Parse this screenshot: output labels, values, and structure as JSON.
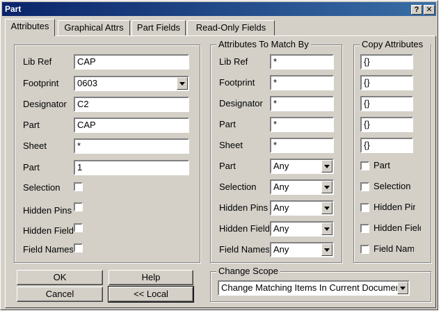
{
  "window": {
    "title": "Part"
  },
  "tabs": [
    "Attributes",
    "Graphical Attrs",
    "Part Fields",
    "Read-Only Fields"
  ],
  "attributes": {
    "lib_ref_label": "Lib Ref",
    "lib_ref": "CAP",
    "footprint_label": "Footprint",
    "footprint": "0603",
    "designator_label": "Designator",
    "designator": "C2",
    "part_label": "Part",
    "part": "CAP",
    "sheet_label": "Sheet",
    "sheet": "*",
    "part_num_label": "Part",
    "part_num": "1",
    "selection_label": "Selection",
    "hidden_pins_label": "Hidden Pins",
    "hidden_fields_label": "Hidden Fields",
    "field_names_label": "Field Names"
  },
  "match": {
    "title": "Attributes To Match By",
    "lib_ref_label": "Lib Ref",
    "lib_ref": "*",
    "footprint_label": "Footprint",
    "footprint": "*",
    "designator_label": "Designator",
    "designator": "*",
    "part_label": "Part",
    "part": "*",
    "sheet_label": "Sheet",
    "sheet": "*",
    "part_num_label": "Part",
    "part_num": "Any",
    "selection_label": "Selection",
    "selection": "Any",
    "hidden_pins_label": "Hidden Pins",
    "hidden_pins": "Any",
    "hidden_fields_label": "Hidden Fields",
    "hidden_fields": "Any",
    "field_names_label": "Field Names",
    "field_names": "Any"
  },
  "copy": {
    "title": "Copy Attributes",
    "f1": "{}",
    "f2": "{}",
    "f3": "{}",
    "f4": "{}",
    "f5": "{}",
    "part_label": "Part",
    "selection_label": "Selection",
    "hidden_pins_label": "Hidden Pins",
    "hidden_fields_label": "Hidden Fields",
    "field_names_label": "Field Names"
  },
  "scope": {
    "title": "Change Scope",
    "value": "Change Matching Items In Current Document"
  },
  "buttons": {
    "ok": "OK",
    "help": "Help",
    "cancel": "Cancel",
    "local": "<< Local"
  }
}
